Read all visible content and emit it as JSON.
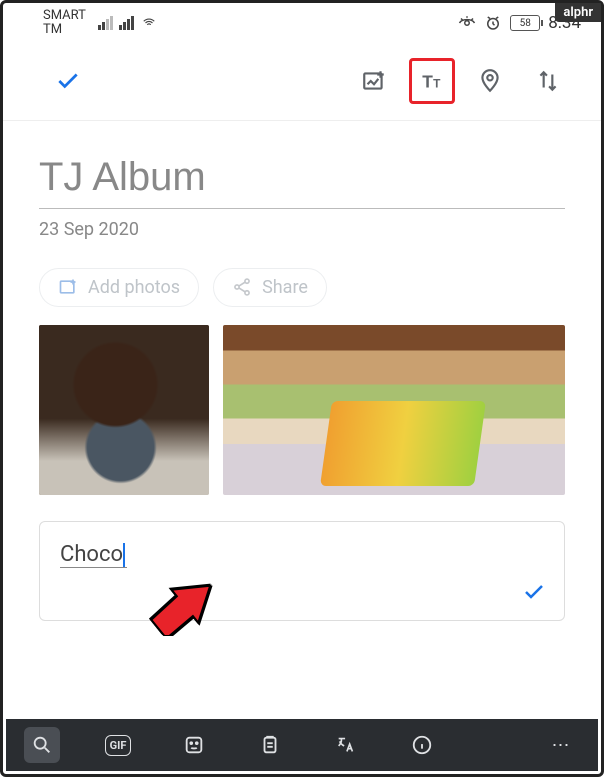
{
  "watermark": "alphr",
  "statusbar": {
    "carrier_line1": "SMART",
    "carrier_line2": "TM",
    "battery": "58",
    "time": "8:34"
  },
  "toolbar": {
    "confirm_icon": "checkmark",
    "add_image_icon": "image-plus",
    "text_icon": "Tt",
    "location_icon": "pin",
    "sort_icon": "sort-arrows"
  },
  "album": {
    "title": "TJ Album",
    "date": "23 Sep 2020",
    "add_photos_label": "Add photos",
    "share_label": "Share"
  },
  "text_entry": {
    "value": "Choco"
  },
  "keyboard_bar": {
    "gif_label": "GIF",
    "items": [
      "search",
      "gif",
      "sticker",
      "clipboard",
      "translate",
      "info",
      "more"
    ]
  }
}
